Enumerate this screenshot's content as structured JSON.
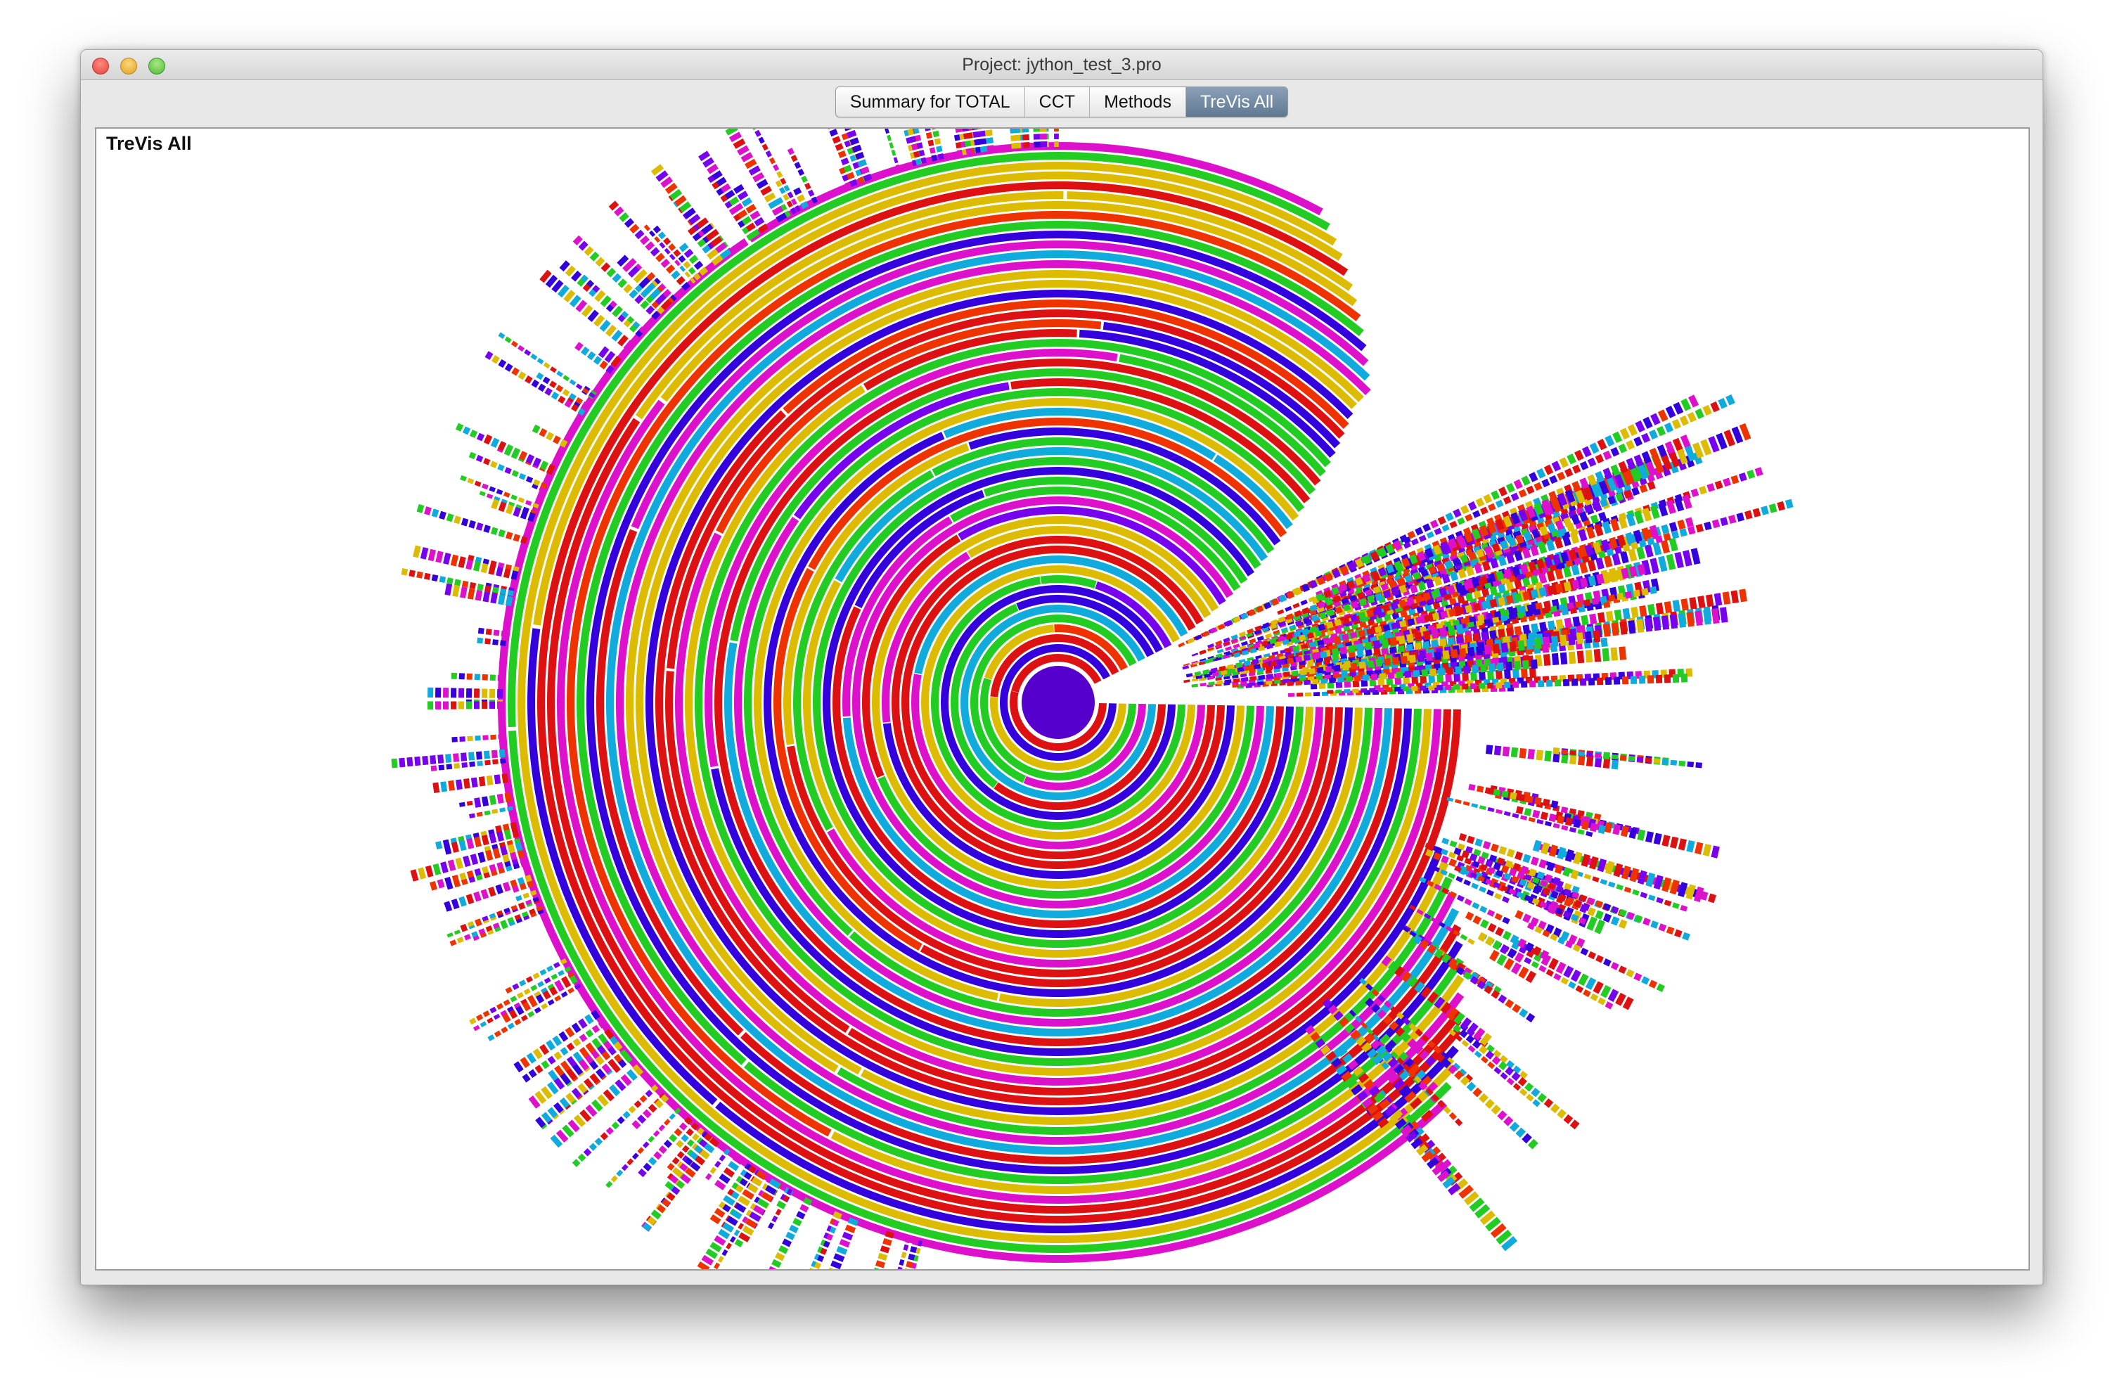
{
  "window": {
    "title": "Project: jython_test_3.pro"
  },
  "tabs": [
    {
      "label": "Summary for TOTAL",
      "active": false
    },
    {
      "label": "CCT",
      "active": false
    },
    {
      "label": "Methods",
      "active": false
    },
    {
      "label": "TreVis All",
      "active": true
    }
  ],
  "panel": {
    "label": "TreVis All"
  },
  "visualization": {
    "type": "sunburst",
    "center_color": "#5500cc",
    "palette": [
      "#dd1111",
      "#3300dd",
      "#ddbb00",
      "#22cc22",
      "#dd11cc",
      "#11aadd",
      "#ee3300",
      "#7700ee"
    ]
  }
}
